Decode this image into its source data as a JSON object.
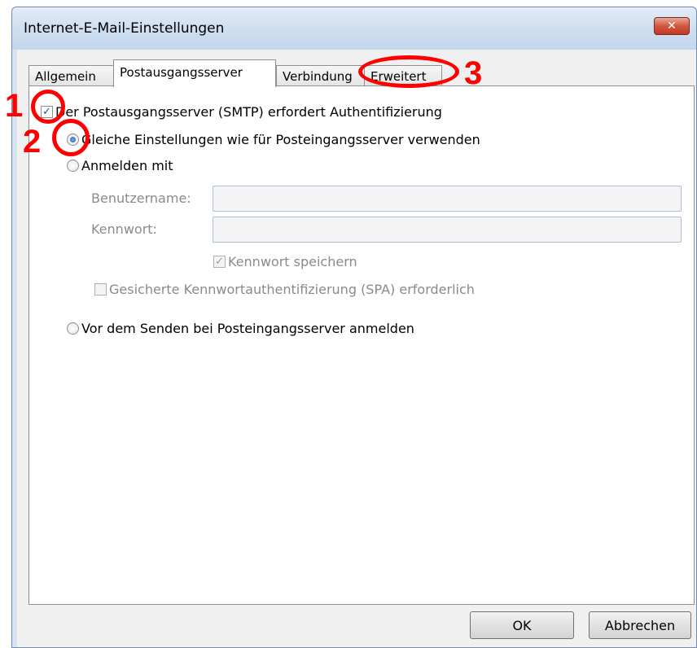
{
  "window": {
    "title": "Internet-E-Mail-Einstellungen",
    "close_icon": "close-icon",
    "close_glyph": "✕"
  },
  "tabs": [
    {
      "label": "Allgemein",
      "active": false
    },
    {
      "label": "Postausgangsserver",
      "active": true
    },
    {
      "label": "Verbindung",
      "active": false
    },
    {
      "label": "Erweitert",
      "active": false
    }
  ],
  "panel": {
    "smtp_auth": {
      "label": "Der Postausgangsserver (SMTP) erfordert Authentifizierung",
      "checked": true
    },
    "same_settings": {
      "label": "Gleiche Einstellungen wie für Posteingangsserver verwenden",
      "selected": true
    },
    "login_with": {
      "label": "Anmelden mit",
      "selected": false
    },
    "username": {
      "label": "Benutzername:",
      "value": ""
    },
    "password": {
      "label": "Kennwort:",
      "value": ""
    },
    "save_password": {
      "label": "Kennwort speichern",
      "checked": true,
      "enabled": false
    },
    "spa": {
      "label": "Gesicherte Kennwortauthentifizierung (SPA) erforderlich",
      "checked": false,
      "enabled": false
    },
    "login_before_send": {
      "label": "Vor dem Senden bei Posteingangsserver anmelden",
      "selected": false
    }
  },
  "buttons": {
    "ok": "OK",
    "cancel": "Abbrechen"
  },
  "annotations": {
    "color": "#ff0000",
    "numbers": [
      "1",
      "2",
      "3"
    ]
  }
}
